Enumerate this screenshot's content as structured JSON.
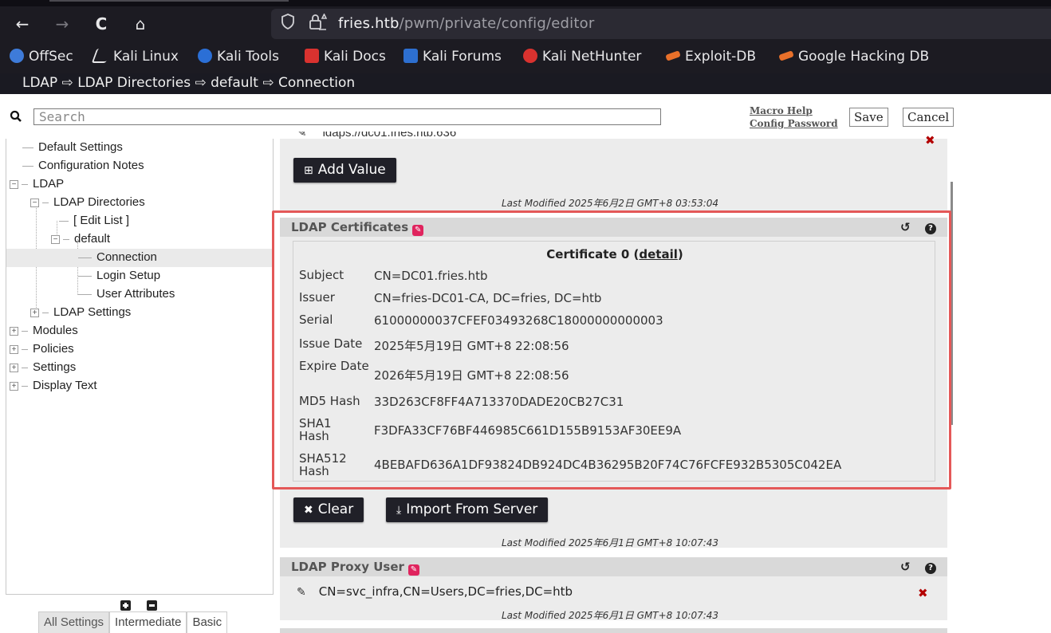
{
  "browser": {
    "back_icon": "←",
    "forward_icon": "→",
    "reload_icon": "C",
    "home_icon": "⌂",
    "url_host": "fries.htb",
    "url_path": "/pwm/private/config/editor",
    "bookmarks": [
      {
        "label": "OffSec",
        "color": "#3e7bd9"
      },
      {
        "label": "Kali Linux",
        "color": "#e8e8ea"
      },
      {
        "label": "Kali Tools",
        "color": "#2b6fd6"
      },
      {
        "label": "Kali Docs",
        "color": "#d9322f"
      },
      {
        "label": "Kali Forums",
        "color": "#2d6fd0"
      },
      {
        "label": "Kali NetHunter",
        "color": "#d9322f"
      },
      {
        "label": "Exploit-DB",
        "color": "#e8702a"
      },
      {
        "label": "Google Hacking DB",
        "color": "#e8702a"
      }
    ]
  },
  "header": {
    "breadcrumb": "LDAP ⇨ LDAP Directories ⇨ default ⇨ Connection"
  },
  "toolbar": {
    "search_placeholder": "Search",
    "macro_help": "Macro Help",
    "config_password": "Config Password",
    "save_label": "Save",
    "cancel_label": "Cancel"
  },
  "tree": {
    "items": [
      {
        "label": "Default Settings"
      },
      {
        "label": "Configuration Notes"
      },
      {
        "label": "LDAP"
      },
      {
        "label": "LDAP Directories"
      },
      {
        "label": "[ Edit List ]"
      },
      {
        "label": "default"
      },
      {
        "label": "Connection"
      },
      {
        "label": "Login Setup"
      },
      {
        "label": "User Attributes"
      },
      {
        "label": "LDAP Settings"
      },
      {
        "label": "Modules"
      },
      {
        "label": "Policies"
      },
      {
        "label": "Settings"
      },
      {
        "label": "Display Text"
      }
    ],
    "levels": [
      "All Settings",
      "Intermediate",
      "Basic"
    ]
  },
  "ldap_urls": {
    "partial_value": "ldaps://dc01.fries.htb:636",
    "add_value_label": "Add Value",
    "last_modified": "Last Modified 2025年6月2日 GMT+8 03:53:04"
  },
  "certificates": {
    "title": "LDAP Certificates",
    "cert_title": "Certificate 0",
    "detail_link": "detail",
    "rows": [
      {
        "k": "Subject",
        "v": "CN=DC01.fries.htb"
      },
      {
        "k": "Issuer",
        "v": "CN=fries-DC01-CA, DC=fries, DC=htb"
      },
      {
        "k": "Serial",
        "v": "61000000037CFEF03493268C18000000000003"
      },
      {
        "k": "Issue Date",
        "v": "2025年5月19日 GMT+8 22:08:56"
      },
      {
        "k": "Expire Date",
        "v": "2026年5月19日 GMT+8 22:08:56"
      },
      {
        "k": "MD5 Hash",
        "v": "33D263CF8FF4A713370DADE20CB27C31"
      },
      {
        "k": "SHA1 Hash",
        "v": "F3DFA33CF76BF446985C661D155B9153AF30EE9A"
      },
      {
        "k": "SHA512 Hash",
        "v": "4BEBAFD636A1DF93824DB924DC4B36295B20F74C76FCFE932B5305C042EA"
      }
    ],
    "clear_label": "Clear",
    "import_label": "Import From Server",
    "last_modified": "Last Modified 2025年6月1日 GMT+8 10:07:43"
  },
  "proxy_user": {
    "title": "LDAP Proxy User",
    "value": "CN=svc_infra,CN=Users,DC=fries,DC=htb",
    "last_modified": "Last Modified 2025年6月1日 GMT+8 10:07:43"
  }
}
